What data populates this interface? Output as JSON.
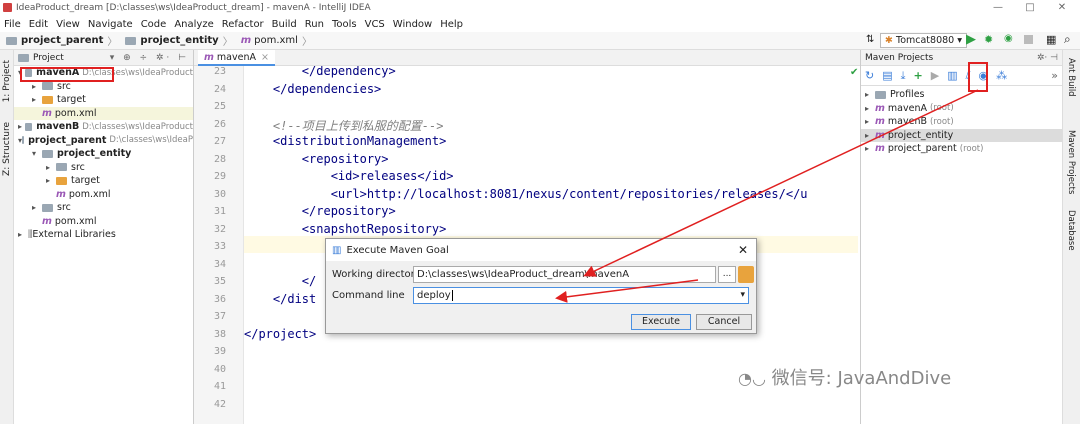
{
  "window": {
    "title": "IdeaProduct_dream [D:\\classes\\ws\\IdeaProduct_dream] - mavenA - IntelliJ IDEA",
    "minimize": "—",
    "maximize": "□",
    "close": "✕"
  },
  "menu": [
    "File",
    "Edit",
    "View",
    "Navigate",
    "Code",
    "Analyze",
    "Refactor",
    "Build",
    "Run",
    "Tools",
    "VCS",
    "Window",
    "Help"
  ],
  "breadcrumb": [
    "project_parent",
    "project_entity",
    "pom.xml"
  ],
  "toolbar": {
    "run_config": "Tomcat8080"
  },
  "project_pane": {
    "title": "Project",
    "tree": [
      {
        "label": "mavenA",
        "path": "D:\\classes\\ws\\IdeaProduct",
        "bold": true,
        "indent": 0,
        "arrow": "▾",
        "kind": "module"
      },
      {
        "label": "src",
        "indent": 1,
        "arrow": "▸",
        "kind": "folder"
      },
      {
        "label": "target",
        "indent": 1,
        "arrow": "▸",
        "kind": "folder-orange"
      },
      {
        "label": "pom.xml",
        "indent": 1,
        "arrow": "",
        "kind": "pom",
        "selected": true
      },
      {
        "label": "mavenB",
        "path": "D:\\classes\\ws\\IdeaProduct",
        "bold": true,
        "indent": 0,
        "arrow": "▸",
        "kind": "module"
      },
      {
        "label": "project_parent",
        "path": "D:\\classes\\ws\\IdeaP",
        "bold": true,
        "indent": 0,
        "arrow": "▾",
        "kind": "module"
      },
      {
        "label": "project_entity",
        "bold": true,
        "indent": 1,
        "arrow": "▾",
        "kind": "module"
      },
      {
        "label": "src",
        "indent": 2,
        "arrow": "▸",
        "kind": "folder"
      },
      {
        "label": "target",
        "indent": 2,
        "arrow": "▸",
        "kind": "folder-orange"
      },
      {
        "label": "pom.xml",
        "indent": 2,
        "arrow": "",
        "kind": "pom"
      },
      {
        "label": "src",
        "indent": 1,
        "arrow": "▸",
        "kind": "folder"
      },
      {
        "label": "pom.xml",
        "indent": 1,
        "arrow": "",
        "kind": "pom"
      },
      {
        "label": "External Libraries",
        "indent": 0,
        "arrow": "▸",
        "kind": "lib"
      }
    ]
  },
  "left_tabs": [
    "1: Project",
    "Z: Structure"
  ],
  "editor": {
    "tab": "mavenA",
    "line_numbers": [
      "23",
      "24",
      "25",
      "26",
      "27",
      "28",
      "29",
      "30",
      "31",
      "32",
      "33",
      "34",
      "35",
      "36",
      "37",
      "38",
      "39",
      "40",
      "41",
      "42"
    ],
    "lines": [
      "        </dependency>",
      "    </dependencies>",
      "",
      "    <!--项目上传到私服的配置-->",
      "    <distributionManagement>",
      "        <repository>",
      "            <id>releases</id>",
      "            <url>http://localhost:8081/nexus/content/repositories/releases/</u",
      "        </repository>",
      "        <snapshotRepository>",
      "",
      "                                                    /s/snapshots/</",
      "        </",
      "    </dist",
      "",
      "</project>",
      "",
      "",
      "",
      ""
    ]
  },
  "maven_pane": {
    "title": "Maven Projects",
    "items": [
      {
        "label": "Profiles",
        "suffix": ""
      },
      {
        "label": "mavenA",
        "suffix": "(root)"
      },
      {
        "label": "mavenB",
        "suffix": "(root)"
      },
      {
        "label": "project_entity",
        "suffix": ""
      },
      {
        "label": "project_parent",
        "suffix": "(root)"
      }
    ]
  },
  "right_tabs": [
    "Ant Build",
    "Maven Projects",
    "Database"
  ],
  "dialog": {
    "title": "Execute Maven Goal",
    "working_dir_label": "Working directory",
    "working_dir_value": "D:\\classes\\ws\\IdeaProduct_dream\\mavenA",
    "browse_label": "...",
    "command_label": "Command line",
    "command_value": "deploy",
    "execute_label": "Execute",
    "cancel_label": "Cancel"
  },
  "watermark": "微信号: JavaAndDive",
  "colors": {
    "highlight_red": "#e02020",
    "accent_blue": "#4a90e2",
    "selection": "#f5f5dc"
  }
}
